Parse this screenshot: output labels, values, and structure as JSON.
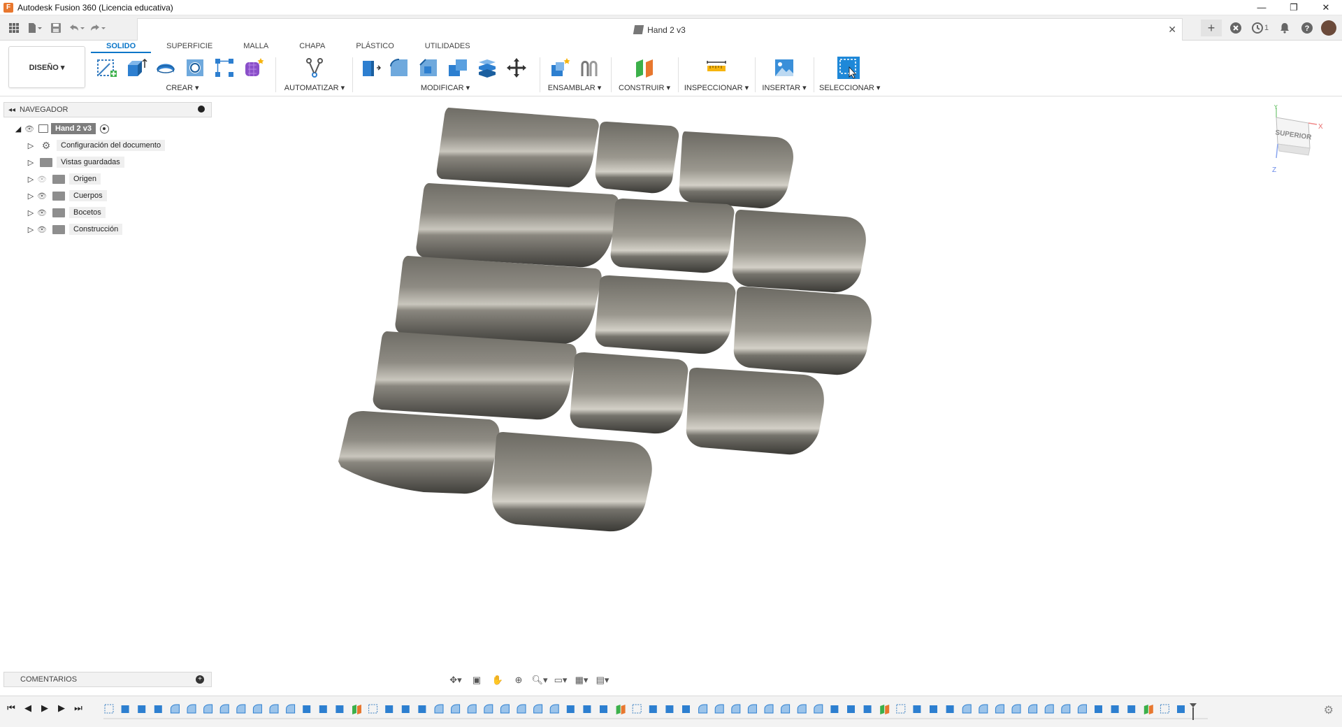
{
  "app": {
    "title": "Autodesk Fusion 360 (Licencia educativa)"
  },
  "window_controls": {
    "minimize": "—",
    "restore": "❐",
    "close": "✕"
  },
  "document": {
    "title": "Hand 2 v3"
  },
  "notifications": {
    "jobs_count": "1"
  },
  "workspace": {
    "label": "DISEÑO ▾"
  },
  "tabs": [
    "SOLIDO",
    "SUPERFICIE",
    "MALLA",
    "CHAPA",
    "PLÁSTICO",
    "UTILIDADES"
  ],
  "groups": {
    "crear": "CREAR ▾",
    "automatizar": "AUTOMATIZAR ▾",
    "modificar": "MODIFICAR ▾",
    "ensamblar": "ENSAMBLAR ▾",
    "construir": "CONSTRUIR ▾",
    "inspeccionar": "INSPECCIONAR ▾",
    "insertar": "INSERTAR ▾",
    "seleccionar": "SELECCIONAR ▾"
  },
  "browser": {
    "header": "NAVEGADOR",
    "root": "Hand 2 v3",
    "items": [
      {
        "label": "Configuración del documento",
        "icon": "gear-icon"
      },
      {
        "label": "Vistas guardadas",
        "icon": "folder-icon"
      },
      {
        "label": "Origen",
        "icon": "folder-icon"
      },
      {
        "label": "Cuerpos",
        "icon": "folder-icon"
      },
      {
        "label": "Bocetos",
        "icon": "folder-icon"
      },
      {
        "label": "Construcción",
        "icon": "folder-icon"
      }
    ]
  },
  "comments": {
    "label": "COMENTARIOS"
  },
  "viewcube": {
    "face": "SUPERIOR",
    "x": "X",
    "y": "Y",
    "z": "Z"
  },
  "colors": {
    "accent": "#0b76c8",
    "body_fill": "#7f7d75",
    "body_dark": "#4a4944"
  }
}
